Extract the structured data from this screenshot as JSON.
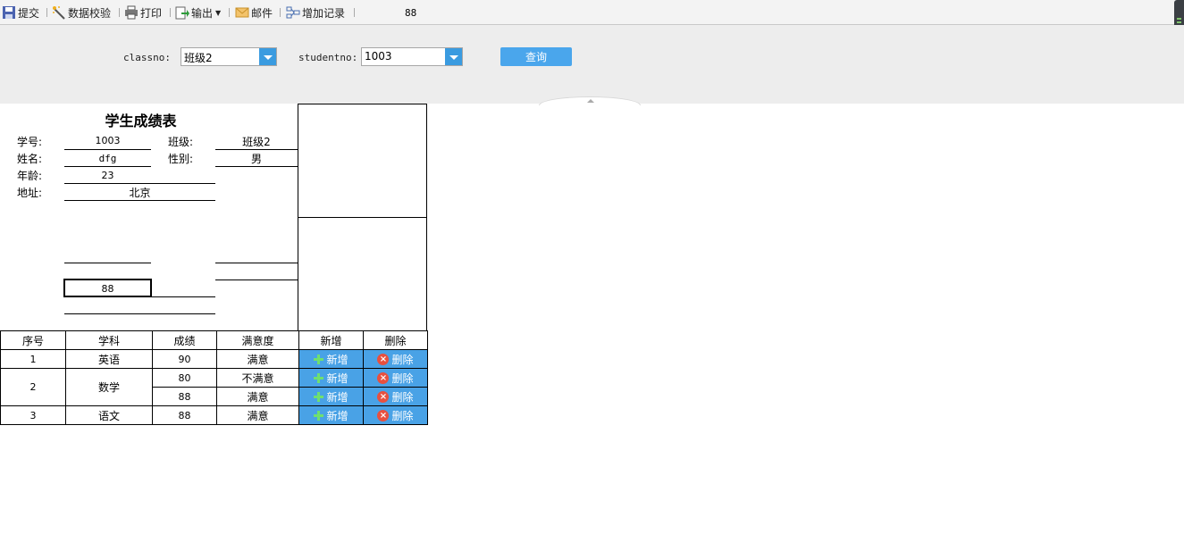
{
  "toolbar": {
    "submit": "提交",
    "validate": "数据校验",
    "print": "打印",
    "export": "输出",
    "mail": "邮件",
    "add_record": "增加记录",
    "page": "88"
  },
  "params": {
    "classno_label": "classno:",
    "classno_value": "班级2",
    "studentno_label": "studentno:",
    "studentno_value": "1003",
    "query_label": "查询"
  },
  "report": {
    "title": "学生成绩表",
    "student_no_label": "学号:",
    "student_no": "1003",
    "class_label": "班级:",
    "class": "班级2",
    "name_label": "姓名:",
    "name": "dfg",
    "gender_label": "性别:",
    "gender": "男",
    "age_label": "年龄:",
    "age": "23",
    "address_label": "地址:",
    "address": "北京",
    "boxed_value": "88"
  },
  "grid": {
    "headers": [
      "序号",
      "学科",
      "成绩",
      "满意度",
      "新增",
      "删除"
    ],
    "add_label": "新增",
    "delete_label": "删除",
    "rows": [
      {
        "no": "1",
        "subject": "英语",
        "score": "90",
        "satisfaction": "满意"
      },
      {
        "no": "2",
        "subject": "数学",
        "score": "80",
        "satisfaction": "不满意"
      },
      {
        "score": "88",
        "satisfaction": "满意"
      },
      {
        "no": "3",
        "subject": "语文",
        "score": "88",
        "satisfaction": "满意"
      }
    ]
  }
}
